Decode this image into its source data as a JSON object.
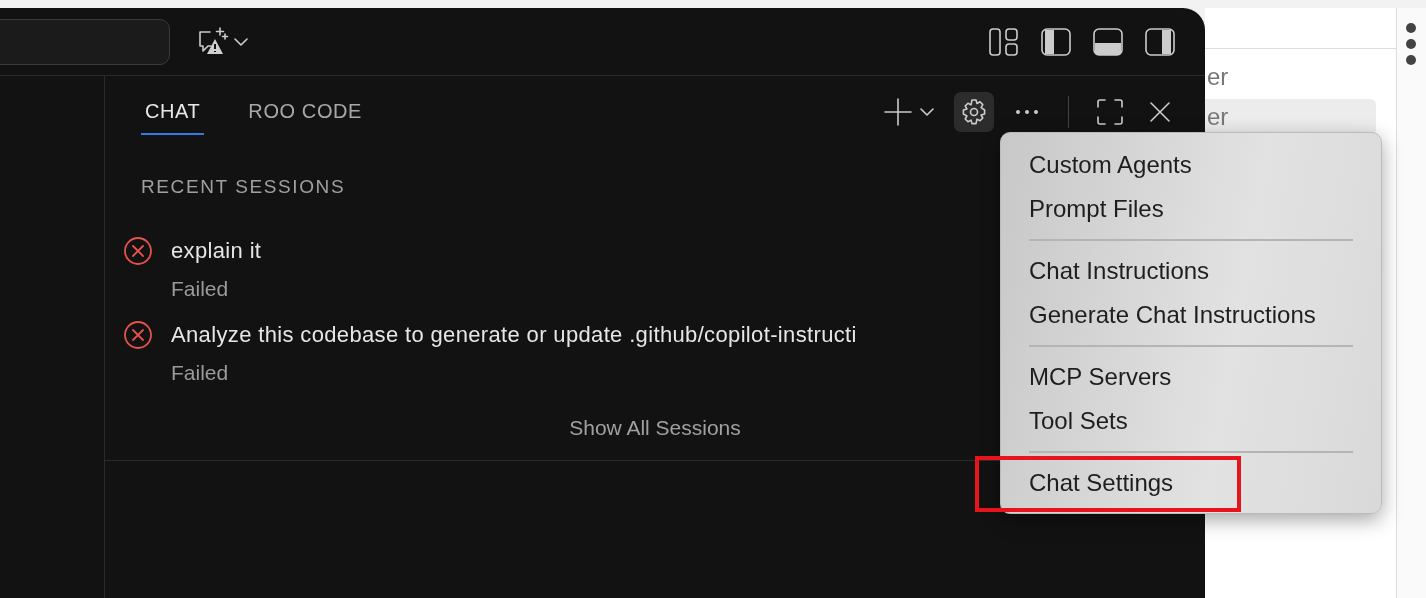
{
  "tabs": [
    {
      "label": "CHAT",
      "selected": true
    },
    {
      "label": "ROO CODE",
      "selected": false
    }
  ],
  "settings_button": {
    "selected": true
  },
  "sessions": {
    "heading": "RECENT SESSIONS",
    "items": [
      {
        "title": "explain it",
        "status": "Failed"
      },
      {
        "title": "Analyze this codebase to generate or update .github/copilot-instructi",
        "status": "Failed"
      }
    ],
    "show_all": "Show All Sessions"
  },
  "background_list": [
    {
      "text": "er",
      "selected": false
    },
    {
      "text": "er",
      "selected": true
    }
  ],
  "menu": {
    "groups": [
      {
        "items": [
          {
            "label": "Custom Agents",
            "annotated": false
          },
          {
            "label": "Prompt Files",
            "annotated": false
          }
        ]
      },
      {
        "items": [
          {
            "label": "Chat Instructions",
            "annotated": false
          },
          {
            "label": "Generate Chat Instructions",
            "annotated": false
          }
        ]
      },
      {
        "items": [
          {
            "label": "MCP Servers",
            "annotated": false
          },
          {
            "label": "Tool Sets",
            "annotated": false
          }
        ]
      },
      {
        "items": [
          {
            "label": "Chat Settings",
            "annotated": true
          }
        ]
      }
    ]
  }
}
